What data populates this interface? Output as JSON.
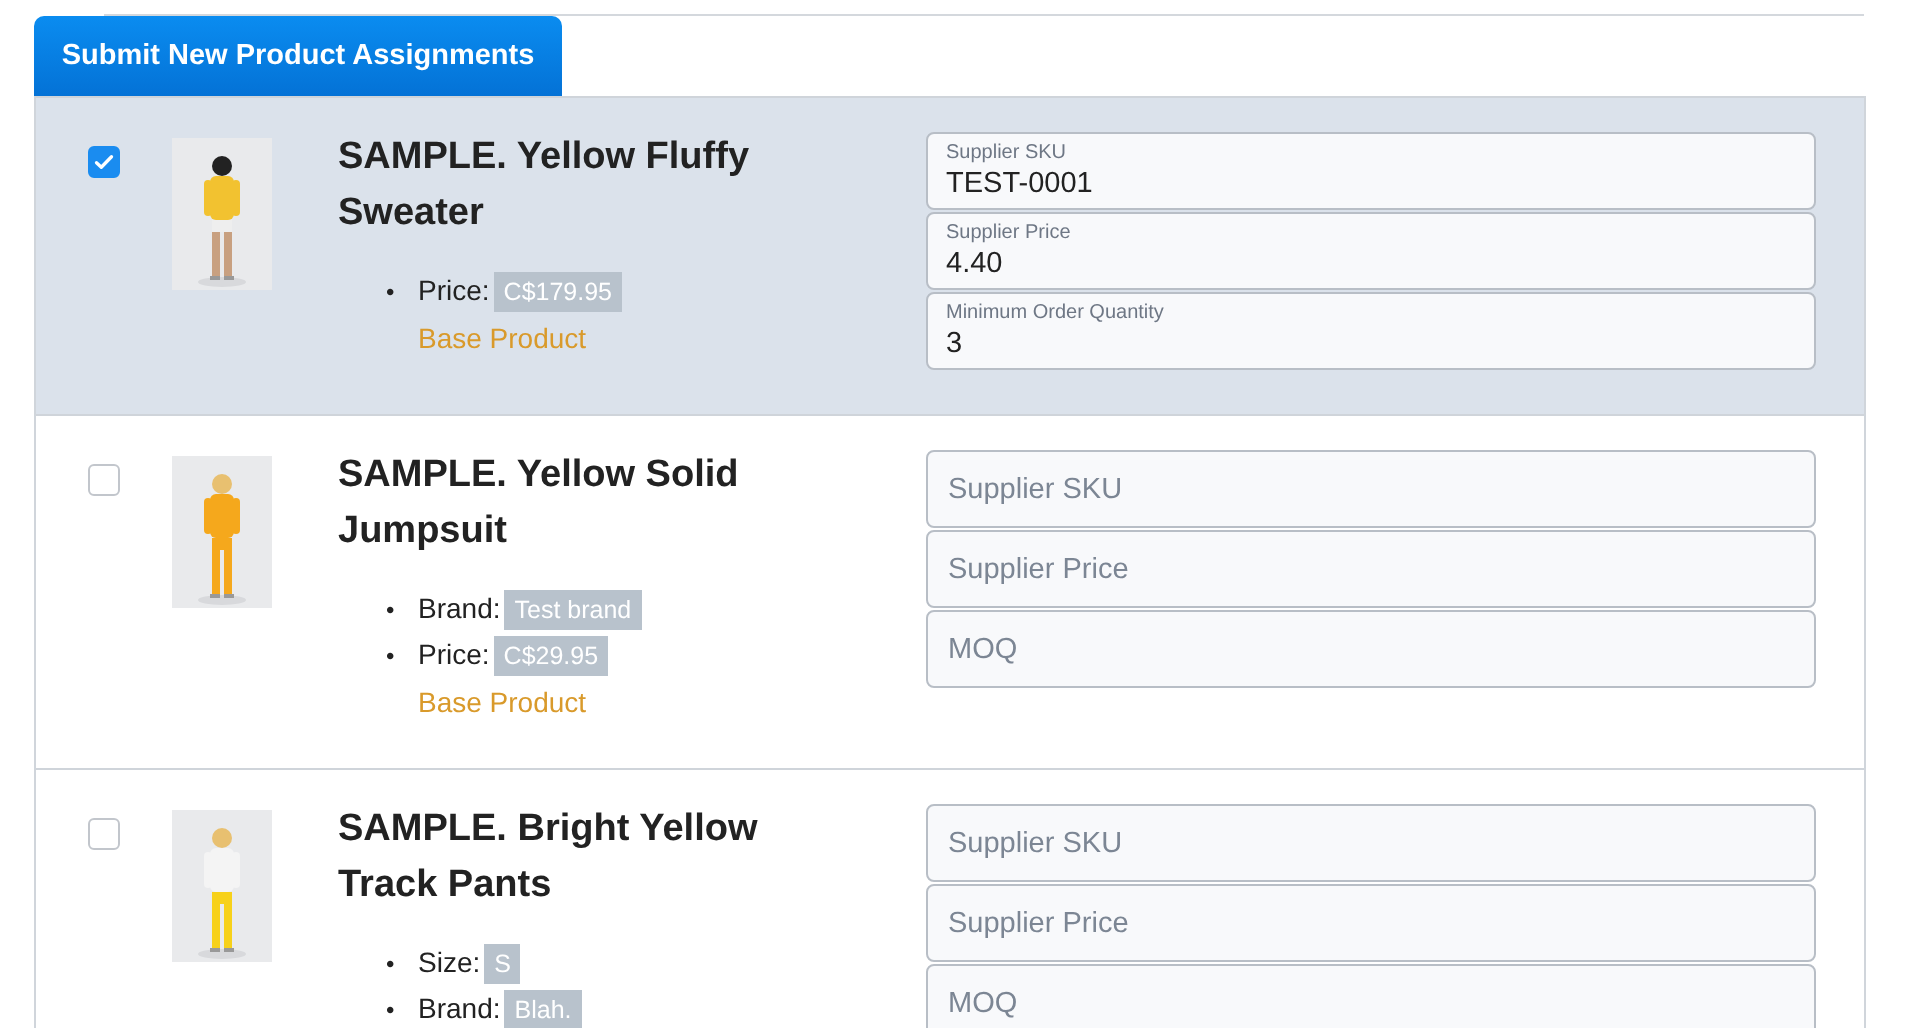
{
  "submit_button": "Submit New Product Assignments",
  "products": [
    {
      "selected": true,
      "title": "SAMPLE. Yellow Fluffy Sweater",
      "attributes": [
        {
          "marker": "•",
          "label": "Price:",
          "value": "C$179.95"
        }
      ],
      "base_label": "Base Product",
      "fields": [
        {
          "kind": "filled",
          "label": "Supplier SKU",
          "value": "TEST-0001"
        },
        {
          "kind": "filled",
          "label": "Supplier Price",
          "value": "4.40"
        },
        {
          "kind": "filled",
          "label": "Minimum Order Quantity",
          "value": "3"
        }
      ]
    },
    {
      "selected": false,
      "title": "SAMPLE. Yellow Solid Jumpsuit",
      "attributes": [
        {
          "marker": "•",
          "label": "Brand:",
          "value": "Test brand"
        },
        {
          "marker": "•",
          "label": "Price:",
          "value": "C$29.95"
        }
      ],
      "base_label": "Base Product",
      "fields": [
        {
          "kind": "empty",
          "placeholder": "Supplier SKU"
        },
        {
          "kind": "empty",
          "placeholder": "Supplier Price"
        },
        {
          "kind": "empty",
          "placeholder": "MOQ"
        }
      ]
    },
    {
      "selected": false,
      "title": "SAMPLE. Bright Yellow Track Pants",
      "attributes": [
        {
          "marker": "•",
          "label": "Size:",
          "value": "S"
        },
        {
          "marker": "•",
          "label": "Brand:",
          "value": "Blah."
        }
      ],
      "fields": [
        {
          "kind": "empty",
          "placeholder": "Supplier SKU"
        },
        {
          "kind": "empty",
          "placeholder": "Supplier Price"
        },
        {
          "kind": "empty",
          "placeholder": "MOQ"
        }
      ]
    }
  ]
}
